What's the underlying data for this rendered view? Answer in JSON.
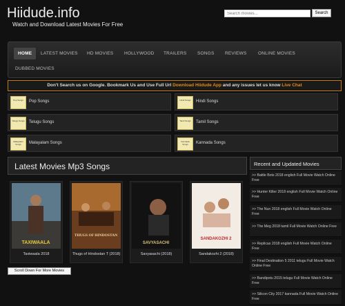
{
  "header": {
    "title": "Hiidude.info",
    "tagline": "Watch and Download Latest Movies For Free",
    "search_placeholder": "Search movies...",
    "search_button": "Search"
  },
  "nav": [
    "HOME",
    "LATEST MOVIES",
    "HD MOVIES",
    "HOLLYWOOD",
    "TRAILERS",
    "SONGS",
    "REVIEWS",
    "ONLINE MOVIES",
    "DUBBED MOVIES"
  ],
  "notice": {
    "part1": "Don't Search us on Google. Bookmark Us and Use Full Url ",
    "link1": "Download Hiidude App",
    "part2": " and any issues let us know ",
    "link2": "Live Chat"
  },
  "categories": [
    {
      "label": "Pop Songs",
      "thumb": "Pop Songs"
    },
    {
      "label": "Hindi Songs",
      "thumb": "Hindi Songs"
    },
    {
      "label": "Telugu Songs",
      "thumb": "Telugu Songs"
    },
    {
      "label": "Tamil Songs",
      "thumb": "Tamil Songs"
    },
    {
      "label": "Malayalam Songs",
      "thumb": "Malayalam Songs"
    },
    {
      "label": "Kannada Songs",
      "thumb": "Kannada Songs"
    }
  ],
  "latest": {
    "heading": "Latest Movies Mp3 Songs",
    "movies": [
      {
        "title": "Taxiwaala 2018",
        "poster_text": "TAXIWAALA"
      },
      {
        "title": "Thugs of Hindostan T (2018)",
        "poster_text": "THUGS OF HINDOSTAN"
      },
      {
        "title": "Savyasachi (2018)",
        "poster_text": "SAVYASACHI"
      },
      {
        "title": "Sandakozhi 2 (2018)",
        "poster_text": "SANDAKOZHI 2"
      }
    ],
    "scroll_button": "Scroll Down For More Movies"
  },
  "sidebar": {
    "heading": "Recent and Updated Movies",
    "items": [
      ">> Battle Bots 2018 english Full Movie Watch Online Free",
      ">> Hunter Killer 2018 english Full Movie Watch Online Free",
      ">> The Nun 2018 english Full Movie Watch Online Free",
      ">> The Meg 2018 tamil Full Movie Watch Online Free",
      ">> Replicas 2018 english Full Movie Watch Online Free",
      ">> Final Destination 5 2011 telugu Full Movie Watch Online Free",
      ">> Bandipotu 2015 telugu Full Movie Watch Online Free",
      ">> Silicon City 2017 kannada Full Movie Watch Online Free"
    ]
  }
}
